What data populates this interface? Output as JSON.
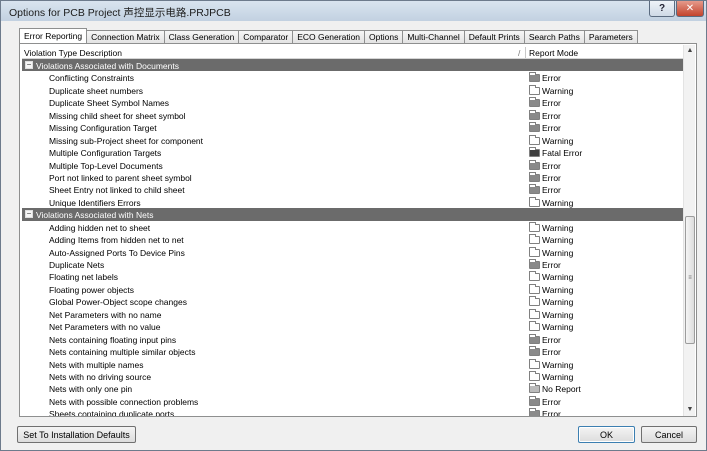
{
  "window": {
    "title": "Options for PCB Project 声控显示电路.PRJPCB",
    "help_label": "?",
    "close_label": "✕"
  },
  "tabs": [
    {
      "label": "Error Reporting",
      "active": true
    },
    {
      "label": "Connection Matrix"
    },
    {
      "label": "Class Generation"
    },
    {
      "label": "Comparator"
    },
    {
      "label": "ECO Generation"
    },
    {
      "label": "Options"
    },
    {
      "label": "Multi-Channel"
    },
    {
      "label": "Default Prints"
    },
    {
      "label": "Search Paths"
    },
    {
      "label": "Parameters"
    }
  ],
  "table": {
    "col_desc": "Violation Type Description",
    "col_sep": "/",
    "col_mode": "Report Mode",
    "groups": [
      {
        "title": "Violations Associated with Documents",
        "toggle": "−",
        "rows": [
          {
            "desc": "Conflicting Constraints",
            "mode": "Error"
          },
          {
            "desc": "Duplicate sheet numbers",
            "mode": "Warning"
          },
          {
            "desc": "Duplicate Sheet Symbol Names",
            "mode": "Error"
          },
          {
            "desc": "Missing child sheet for sheet symbol",
            "mode": "Error"
          },
          {
            "desc": "Missing Configuration Target",
            "mode": "Error"
          },
          {
            "desc": "Missing sub-Project sheet for component",
            "mode": "Warning"
          },
          {
            "desc": "Multiple Configuration Targets",
            "mode": "Fatal Error"
          },
          {
            "desc": "Multiple Top-Level Documents",
            "mode": "Error"
          },
          {
            "desc": "Port not linked to parent sheet symbol",
            "mode": "Error"
          },
          {
            "desc": "Sheet Entry not linked to child sheet",
            "mode": "Error"
          },
          {
            "desc": "Unique Identifiers Errors",
            "mode": "Warning"
          }
        ]
      },
      {
        "title": "Violations Associated with Nets",
        "toggle": "−",
        "rows": [
          {
            "desc": "Adding hidden net to sheet",
            "mode": "Warning"
          },
          {
            "desc": "Adding Items from hidden net to net",
            "mode": "Warning"
          },
          {
            "desc": "Auto-Assigned Ports To Device Pins",
            "mode": "Warning"
          },
          {
            "desc": "Duplicate Nets",
            "mode": "Error"
          },
          {
            "desc": "Floating net labels",
            "mode": "Warning"
          },
          {
            "desc": "Floating power objects",
            "mode": "Warning"
          },
          {
            "desc": "Global Power-Object scope changes",
            "mode": "Warning"
          },
          {
            "desc": "Net Parameters with no name",
            "mode": "Warning"
          },
          {
            "desc": "Net Parameters with no value",
            "mode": "Warning"
          },
          {
            "desc": "Nets containing floating input pins",
            "mode": "Error"
          },
          {
            "desc": "Nets containing multiple similar objects",
            "mode": "Error"
          },
          {
            "desc": "Nets with multiple names",
            "mode": "Warning"
          },
          {
            "desc": "Nets with no driving source",
            "mode": "Warning"
          },
          {
            "desc": "Nets with only one pin",
            "mode": "No Report"
          },
          {
            "desc": "Nets with possible connection problems",
            "mode": "Error"
          },
          {
            "desc": "Sheets containing duplicate ports",
            "mode": "Error"
          }
        ]
      }
    ]
  },
  "scrollbar": {
    "up": "▲",
    "down": "▼",
    "grip": "≡"
  },
  "buttons": {
    "defaults": "Set To Installation Defaults",
    "ok": "OK",
    "cancel": "Cancel"
  },
  "colors": {
    "group_header": "#6b6b6b",
    "error_folder": "#8a8a8a",
    "fatal_folder": "#3f3f3f"
  }
}
